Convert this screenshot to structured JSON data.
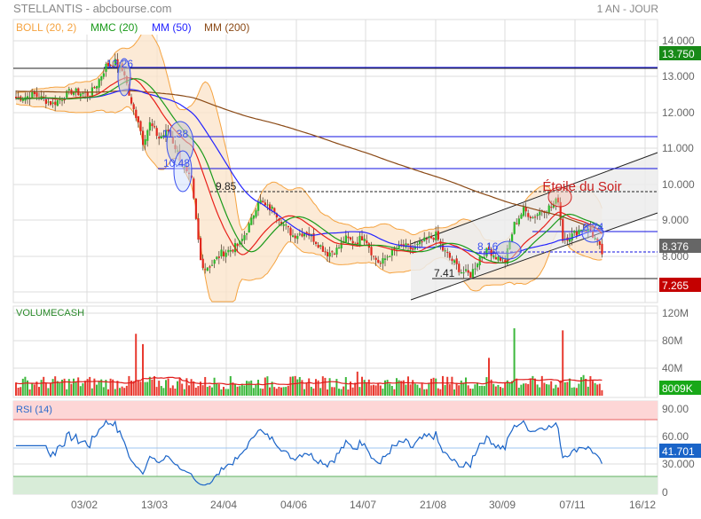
{
  "header": {
    "title": "STELLANTIS - abcbourse.com",
    "period": "1 AN - JOUR"
  },
  "legend": [
    {
      "label": "BOLL (20, 2)",
      "color": "#f5a340"
    },
    {
      "label": "MMC (20)",
      "color": "#1a9a1a"
    },
    {
      "label": "MM (50)",
      "color": "#2424ff"
    },
    {
      "label": "MM (200)",
      "color": "#8b4a16"
    }
  ],
  "price_axis": [
    "14.000",
    "13.000",
    "12.000",
    "11.000",
    "10.000",
    "9.000",
    "8.000"
  ],
  "price_tags": {
    "high": "13.750",
    "last": "8.376",
    "low": "7.265"
  },
  "annotations": {
    "l1326": "13.26",
    "l1138": "11.38",
    "l1048": "10.48",
    "l985": "9.85",
    "l874": "8.74",
    "l816": "8.16",
    "l741": "7.41",
    "pattern": "Étoile du Soir"
  },
  "volume": {
    "title": "VOLUMECASH",
    "axis": [
      "120M",
      "80M",
      "40M"
    ],
    "last": "8009K"
  },
  "rsi": {
    "title": "RSI (14)",
    "axis": [
      "90.00",
      "60.00",
      "30.000",
      "0"
    ],
    "last": "41.701"
  },
  "dates": [
    "03/02",
    "13/03",
    "24/04",
    "04/06",
    "14/07",
    "21/08",
    "30/09",
    "07/11",
    "16/12"
  ],
  "chart_data": {
    "type": "candlestick",
    "title": "STELLANTIS",
    "ylim": [
      7,
      14.4
    ],
    "days": 255,
    "close_keypoints": [
      [
        0,
        12.4
      ],
      [
        8,
        12.5
      ],
      [
        16,
        12.25
      ],
      [
        24,
        12.6
      ],
      [
        32,
        12.5
      ],
      [
        35,
        12.8
      ],
      [
        39,
        13.3
      ],
      [
        43,
        13.4
      ],
      [
        47,
        13.1
      ],
      [
        50,
        12.2
      ],
      [
        53,
        11.8
      ],
      [
        55,
        11.2
      ],
      [
        58,
        11.7
      ],
      [
        62,
        11.3
      ],
      [
        66,
        11.5
      ],
      [
        70,
        10.9
      ],
      [
        74,
        10.3
      ],
      [
        76,
        10.1
      ],
      [
        78,
        9.0
      ],
      [
        80,
        7.9
      ],
      [
        82,
        7.7
      ],
      [
        85,
        7.8
      ],
      [
        89,
        8.1
      ],
      [
        93,
        8.2
      ],
      [
        97,
        8.35
      ],
      [
        102,
        9.0
      ],
      [
        105,
        9.6
      ],
      [
        108,
        9.4
      ],
      [
        112,
        9.3
      ],
      [
        116,
        8.9
      ],
      [
        120,
        8.6
      ],
      [
        126,
        8.7
      ],
      [
        132,
        8.3
      ],
      [
        135,
        8.1
      ],
      [
        139,
        8.2
      ],
      [
        143,
        8.5
      ],
      [
        147,
        8.4
      ],
      [
        151,
        8.6
      ],
      [
        155,
        8.0
      ],
      [
        158,
        7.8
      ],
      [
        162,
        8.1
      ],
      [
        168,
        8.3
      ],
      [
        172,
        8.2
      ],
      [
        176,
        8.4
      ],
      [
        182,
        8.6
      ],
      [
        185,
        8.2
      ],
      [
        189,
        7.9
      ],
      [
        193,
        7.6
      ],
      [
        197,
        7.5
      ],
      [
        201,
        8.0
      ],
      [
        205,
        8.2
      ],
      [
        208,
        8.0
      ],
      [
        212,
        7.9
      ],
      [
        216,
        8.9
      ],
      [
        220,
        9.3
      ],
      [
        224,
        9.1
      ],
      [
        228,
        9.3
      ],
      [
        232,
        9.4
      ],
      [
        235,
        9.6
      ],
      [
        237,
        8.5
      ],
      [
        241,
        8.6
      ],
      [
        245,
        8.8
      ],
      [
        249,
        8.7
      ],
      [
        251,
        8.5
      ],
      [
        254,
        8.1
      ]
    ],
    "volume_base_m": 18,
    "volume_spikes": [
      [
        52,
        90
      ],
      [
        55,
        75
      ],
      [
        148,
        35
      ],
      [
        205,
        55
      ],
      [
        216,
        98
      ],
      [
        237,
        95
      ],
      [
        246,
        30
      ]
    ],
    "levels": [
      13.75,
      13.26,
      11.38,
      10.48,
      9.85,
      8.74,
      8.16,
      7.41
    ],
    "rsi_zones": {
      "overbought": 70,
      "oversold": 20
    }
  }
}
